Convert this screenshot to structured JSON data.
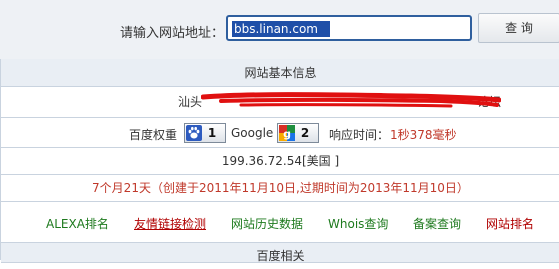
{
  "search": {
    "label": "请输入网站地址：",
    "value": "bbs.linan.com",
    "button": "查 询"
  },
  "table": {
    "title": "网站基本信息",
    "host_prefix": "汕头",
    "host_suffix": "论坛",
    "baidu": {
      "label": "百度权重",
      "value": "1"
    },
    "google": {
      "label": "Google",
      "value": "2"
    },
    "response": {
      "label": "响应时间：",
      "value": "1秒378毫秒"
    },
    "ip": "199.36.72.54[美国 ]",
    "age": {
      "duration": "7个月21天",
      "detail": "（创建于2011年11月10日,过期时间为2013年11月10日）"
    },
    "links": [
      {
        "label": "ALEXA排名",
        "color": "#1e7a1e"
      },
      {
        "label": "友情链接检测",
        "color": "#b00000"
      },
      {
        "label": "网站历史数据",
        "color": "#1e7a1e"
      },
      {
        "label": "Whois查询",
        "color": "#1e7a1e"
      },
      {
        "label": "备案查询",
        "color": "#1e7a1e"
      },
      {
        "label": "网站排名",
        "color": "#b00000"
      }
    ],
    "bottom_title": "百度相关"
  },
  "icons": {
    "baidu": "baidu-paw-icon",
    "google": "google-icon"
  }
}
